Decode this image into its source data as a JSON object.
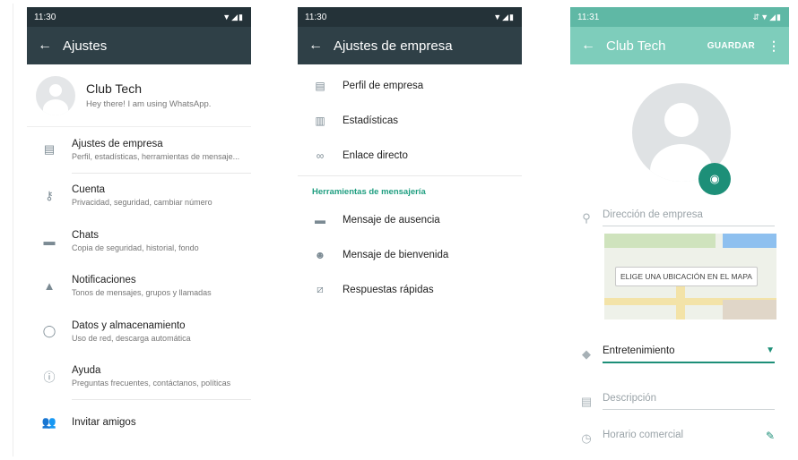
{
  "screen1": {
    "status": {
      "time": "11:30",
      "icons": "▼◢▮"
    },
    "appbar": {
      "back_icon": "←",
      "title": "Ajustes"
    },
    "profile": {
      "name": "Club Tech",
      "about": "Hey there! I am using WhatsApp."
    },
    "items": [
      {
        "icon": "store-icon",
        "title": "Ajustes de empresa",
        "subtitle": "Perfil, estadísticas, herramientas de mensaje..."
      },
      {
        "icon": "key-icon",
        "title": "Cuenta",
        "subtitle": "Privacidad, seguridad, cambiar número"
      },
      {
        "icon": "chat-icon",
        "title": "Chats",
        "subtitle": "Copia de seguridad, historial, fondo"
      },
      {
        "icon": "bell-icon",
        "title": "Notificaciones",
        "subtitle": "Tonos de mensajes, grupos y llamadas"
      },
      {
        "icon": "data-usage-icon",
        "title": "Datos y almacenamiento",
        "subtitle": "Uso de red, descarga automática"
      },
      {
        "icon": "help-icon",
        "title": "Ayuda",
        "subtitle": "Preguntas frecuentes, contáctanos, políticas"
      },
      {
        "icon": "people-icon",
        "title": "Invitar amigos",
        "subtitle": ""
      }
    ]
  },
  "screen2": {
    "status": {
      "time": "11:30",
      "icons": "▼◢▮"
    },
    "appbar": {
      "back_icon": "←",
      "title": "Ajustes de empresa"
    },
    "items": [
      {
        "icon": "store-icon",
        "label": "Perfil de empresa"
      },
      {
        "icon": "bar-chart-icon",
        "label": "Estadísticas"
      },
      {
        "icon": "link-icon",
        "label": "Enlace directo"
      }
    ],
    "section_title": "Herramientas de mensajería",
    "tools": [
      {
        "icon": "away-message-icon",
        "label": "Mensaje de ausencia"
      },
      {
        "icon": "greeting-message-icon",
        "label": "Mensaje de bienvenida"
      },
      {
        "icon": "quick-reply-icon",
        "label": "Respuestas rápidas"
      }
    ]
  },
  "screen3": {
    "status": {
      "time": "11:31",
      "icons": "⇵▼◢▮"
    },
    "appbar": {
      "back_icon": "←",
      "title": "Club Tech",
      "save_label": "GUARDAR",
      "more_icon": "⋮"
    },
    "address_placeholder": "Dirección de empresa",
    "map_label": "ELIGE UNA UBICACIÓN EN EL MAPA",
    "category_value": "Entretenimiento",
    "description_placeholder": "Descripción",
    "hours_label": "Horario comercial"
  },
  "colors": {
    "dark_header": "#2f4047",
    "teal_header": "#7ecdbb",
    "accent": "#1d8f78"
  }
}
